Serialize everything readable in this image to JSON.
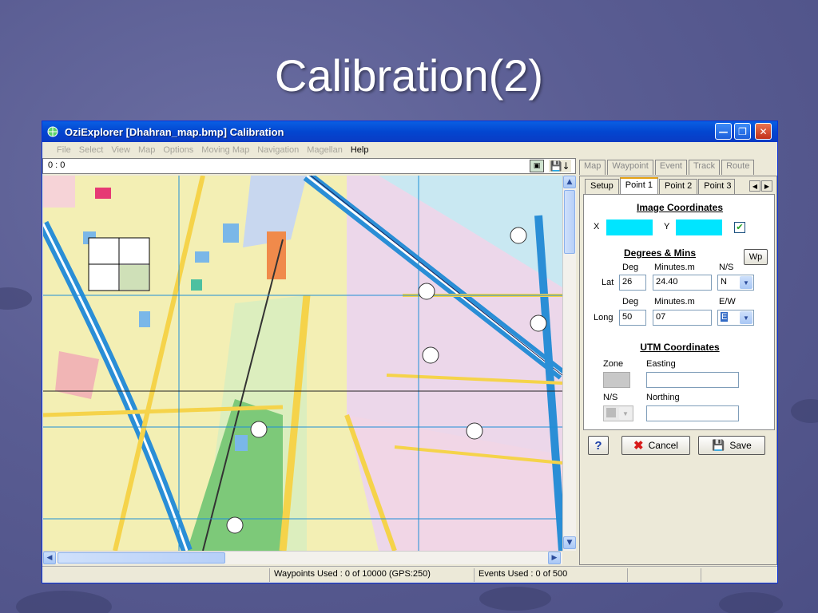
{
  "slide": {
    "title": "Calibration(2)"
  },
  "window": {
    "title": "OziExplorer [Dhahran_map.bmp] Calibration"
  },
  "menu": {
    "items": [
      "File",
      "Select",
      "View",
      "Map",
      "Options",
      "Moving Map",
      "Navigation",
      "Magellan",
      "Help"
    ],
    "active": "Help"
  },
  "coords": {
    "value": "0 : 0"
  },
  "top_tabs": [
    "Map",
    "Waypoint",
    "Event",
    "Track",
    "Route"
  ],
  "panel": {
    "tabs": [
      "Setup",
      "Point 1",
      "Point 2",
      "Point 3"
    ],
    "active_tab": "Point 1",
    "image_coords": {
      "title": "Image Coordinates",
      "x_label": "X",
      "y_label": "Y",
      "checked": true
    },
    "degrees": {
      "title": "Degrees & Mins",
      "wp_button": "Wp",
      "col_deg": "Deg",
      "col_min": "Minutes.m",
      "col_ns": "N/S",
      "col_ew": "E/W",
      "lat_label": "Lat",
      "lat_deg": "26",
      "lat_min": "24.40",
      "lat_dir": "N",
      "long_label": "Long",
      "long_deg": "50",
      "long_min": "07",
      "long_dir": "E"
    },
    "utm": {
      "title": "UTM Coordinates",
      "zone_label": "Zone",
      "easting_label": "Easting",
      "ns_label": "N/S",
      "northing_label": "Northing"
    },
    "buttons": {
      "help": "?",
      "cancel": "Cancel",
      "save": "Save"
    }
  },
  "status": {
    "waypoints": "Waypoints Used : 0 of 10000  (GPS:250)",
    "events": "Events Used : 0 of 500"
  },
  "colors": {
    "accent": "#0a5fe3",
    "highlight_cyan": "#00e5ff",
    "map_road_blue": "#2a8ed6"
  }
}
